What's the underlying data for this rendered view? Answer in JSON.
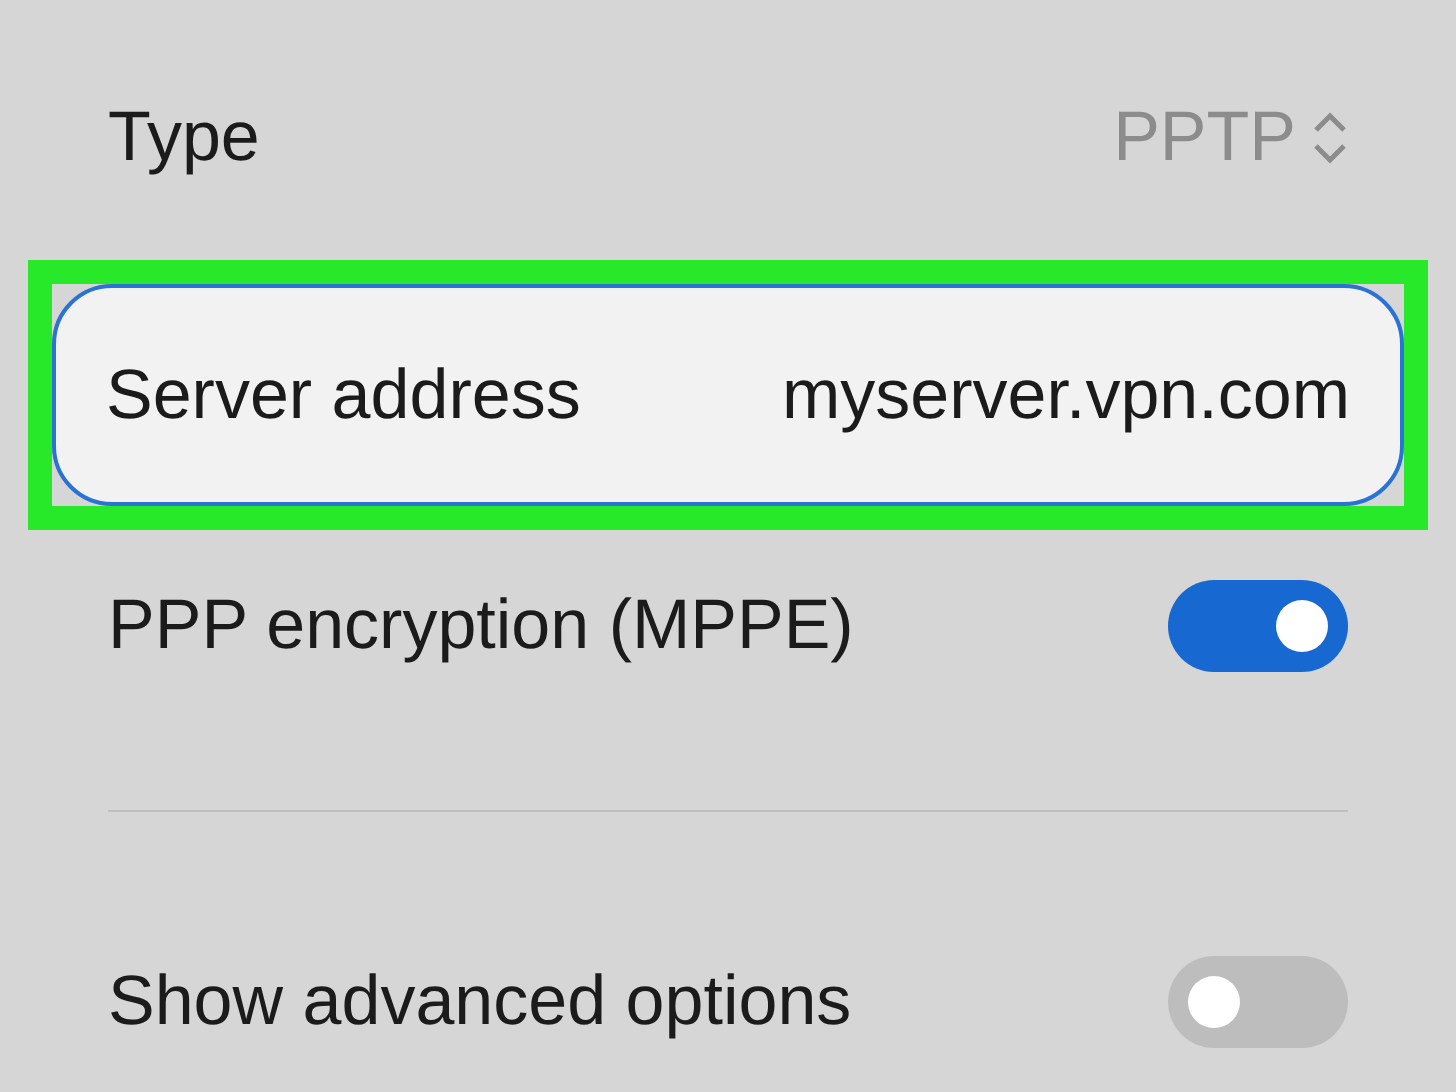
{
  "type_row": {
    "label": "Type",
    "value": "PPTP"
  },
  "server_address": {
    "label": "Server address",
    "value": "myserver.vpn.com",
    "highlighted": true
  },
  "toggles": [
    {
      "label": "PPP encryption (MPPE)",
      "on": true
    },
    {
      "label": "Show advanced options",
      "on": false
    }
  ]
}
